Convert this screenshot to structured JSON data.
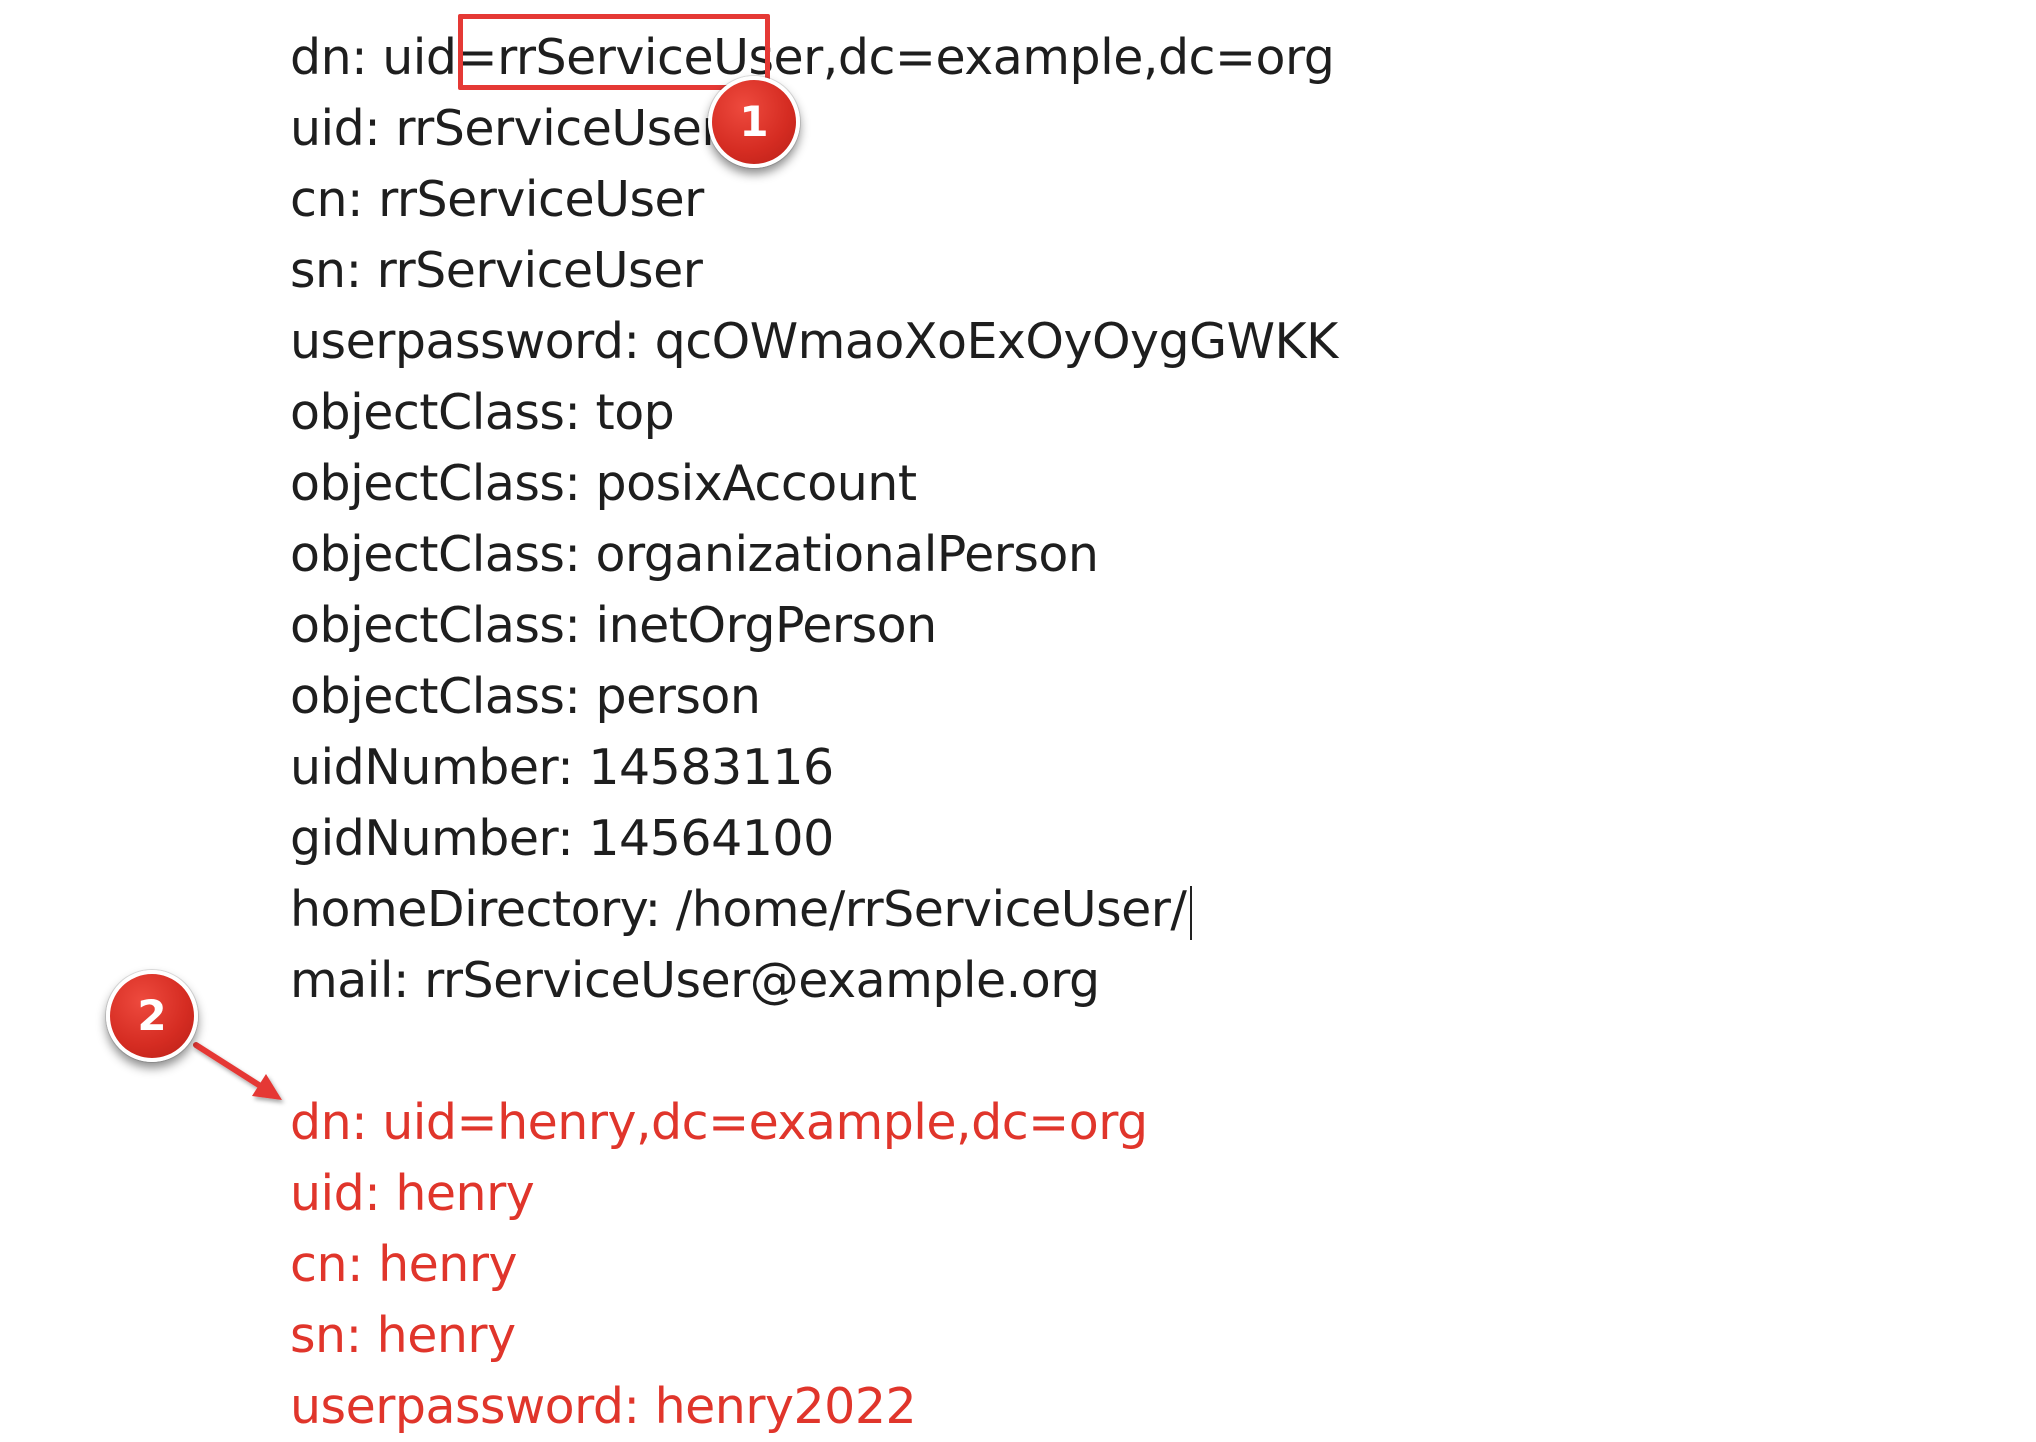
{
  "existing_entry": [
    "dn: uid=rrServiceUser,dc=example,dc=org",
    "uid: rrServiceUser",
    "cn: rrServiceUser",
    "sn: rrServiceUser",
    "userpassword: qcOWmaoXoExOyOygGWKK",
    "objectClass: top",
    "objectClass: posixAccount",
    "objectClass: organizationalPerson",
    "objectClass: inetOrgPerson",
    "objectClass: person",
    "uidNumber: 14583116",
    "gidNumber: 14564100",
    "homeDirectory: /home/rrServiceUser/",
    "mail: rrServiceUser@example.org"
  ],
  "new_entry": [
    "dn: uid=henry,dc=example,dc=org",
    "uid: henry",
    "cn: henry",
    "sn: henry",
    "userpassword: henry2022"
  ],
  "callouts": {
    "first": "1",
    "second": "2"
  },
  "colors": {
    "existing_text": "#1e1e1e",
    "new_entry_text": "#e0352b",
    "annotation_red": "#e53935"
  }
}
